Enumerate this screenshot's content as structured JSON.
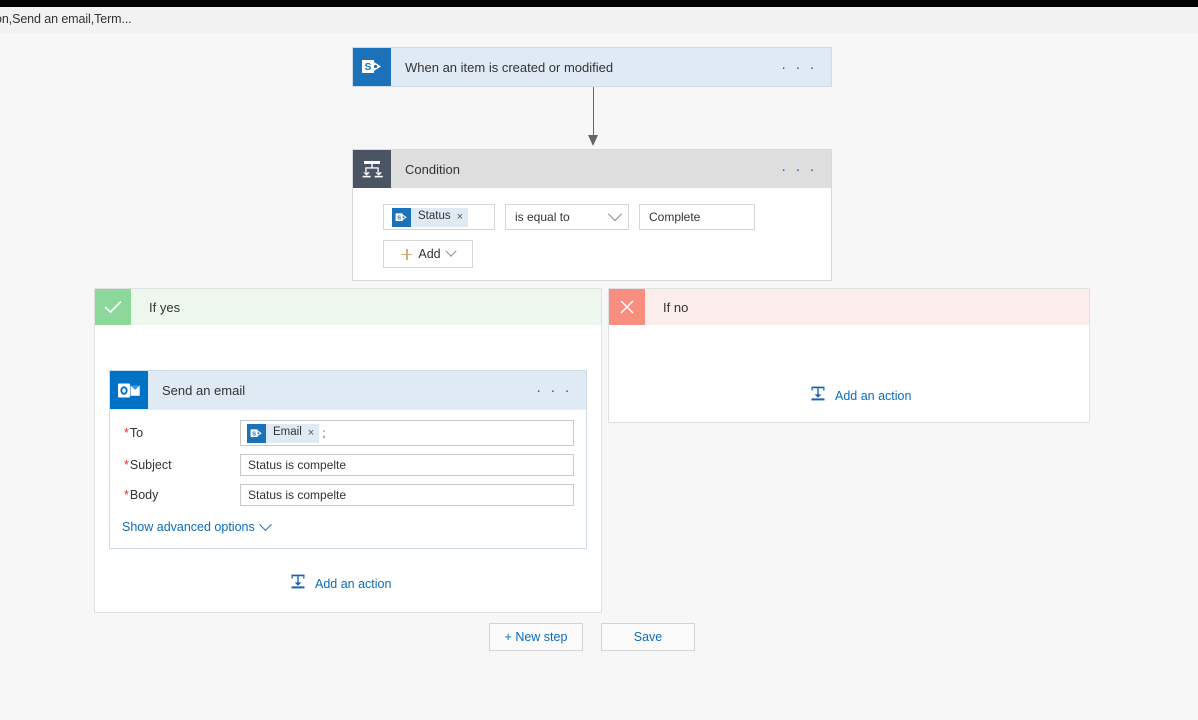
{
  "breadcrumb": {
    "text": "on,Send an email,Term..."
  },
  "trigger": {
    "title": "When an item is created or modified",
    "icon": "sharepoint-icon",
    "menu": "· · ·"
  },
  "condition": {
    "title": "Condition",
    "icon": "condition-icon",
    "menu": "· · ·",
    "token": {
      "label": "Status",
      "remove": "×"
    },
    "operator": "is equal to",
    "value": "Complete",
    "add_label": "Add"
  },
  "branches": {
    "yes": {
      "label": "If yes",
      "mark": "check-icon",
      "mark_color": "#8cd79a",
      "header_color": "#eef7ee",
      "add_action_label": "Add an action"
    },
    "no": {
      "label": "If no",
      "mark": "cross-icon",
      "mark_color": "#f98d7f",
      "header_color": "#fdeeee",
      "add_action_label": "Add an action"
    }
  },
  "email_action": {
    "title": "Send an email",
    "icon": "outlook-icon",
    "menu": "· · ·",
    "fields": [
      {
        "label": "To",
        "required": "*",
        "type": "token",
        "token_label": "Email",
        "token_remove": "×",
        "trailing": ";"
      },
      {
        "label": "Subject",
        "required": "*",
        "type": "text",
        "value": "Status is compelte"
      },
      {
        "label": "Body",
        "required": "*",
        "type": "text",
        "value": "Status is compelte"
      }
    ],
    "advanced_label": "Show advanced options"
  },
  "footer": {
    "new_step_label": "+ New step",
    "save_label": "Save"
  },
  "colors": {
    "accent_blue": "#0b6cbe",
    "sharepoint_blue": "#1b72b8",
    "outlook_blue": "#0072c6",
    "condition_gray": "#4b5463",
    "card_blue_bg": "#dfeaf4",
    "card_gray_bg": "#dedede",
    "required_red": "#d13438"
  }
}
